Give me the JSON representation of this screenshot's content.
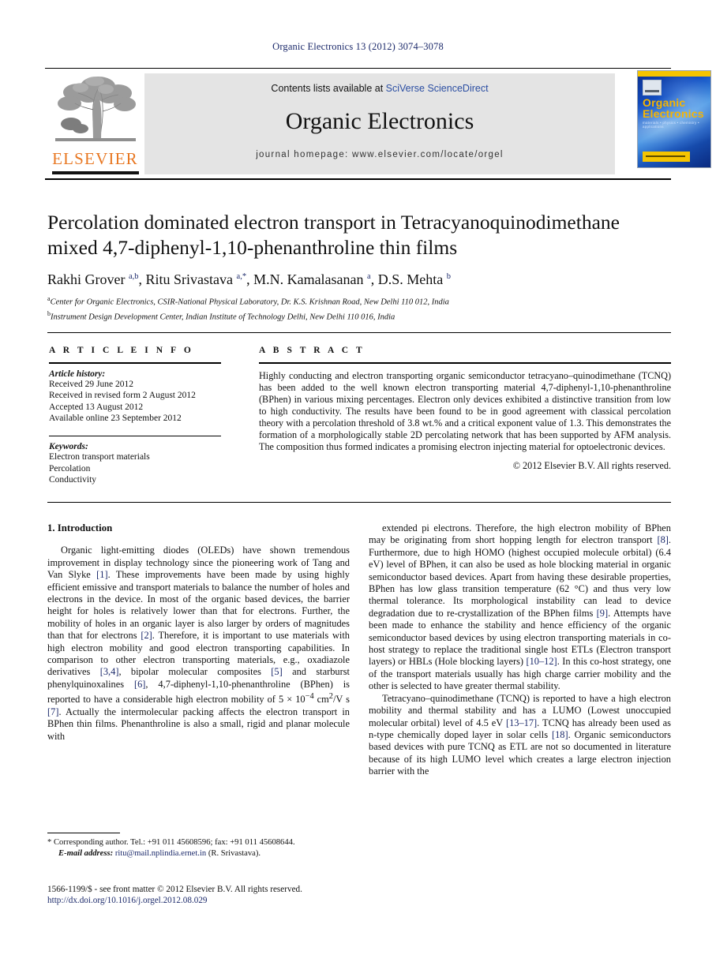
{
  "running_head": "Organic Electronics 13 (2012) 3074–3078",
  "masthead": {
    "contents_prefix": "Contents lists available at ",
    "contents_link": "SciVerse ScienceDirect",
    "journal_title": "Organic Electronics",
    "homepage": "journal homepage: www.elsevier.com/locate/orgel",
    "publisher_name": "ELSEVIER",
    "cover": {
      "title_line1": "Organic",
      "title_line2": "Electronics",
      "subtitle": "materials • physics • chemistry • applications"
    }
  },
  "article": {
    "title": "Percolation dominated electron transport in Tetracyanoquinodimethane mixed 4,7-diphenyl-1,10-phenanthroline thin films",
    "authors_html": "Rakhi Grover <sup>a,b</sup>, Ritu Srivastava <sup>a,*</sup>, M.N. Kamalasanan <sup>a</sup>, D.S. Mehta <sup>b</sup>",
    "affiliation_a": "Center for Organic Electronics, CSIR-National Physical Laboratory, Dr. K.S. Krishnan Road, New Delhi 110 012, India",
    "affiliation_b": "Instrument Design Development Center, Indian Institute of Technology Delhi, New Delhi 110 016, India"
  },
  "article_info": {
    "heading": "A R T I C L E   I N F O",
    "history_label": "Article history:",
    "history": [
      "Received 29 June 2012",
      "Received in revised form 2 August 2012",
      "Accepted 13 August 2012",
      "Available online 23 September 2012"
    ],
    "keywords_label": "Keywords:",
    "keywords": [
      "Electron transport materials",
      "Percolation",
      "Conductivity"
    ]
  },
  "abstract": {
    "heading": "A B S T R A C T",
    "text": "Highly conducting and electron transporting organic semiconductor tetracyano–quinodimethane (TCNQ) has been added to the well known electron transporting material 4,7-diphenyl-1,10-phenanthroline (BPhen) in various mixing percentages. Electron only devices exhibited a distinctive transition from low to high conductivity. The results have been found to be in good agreement with classical percolation theory with a percolation threshold of 3.8 wt.% and a critical exponent value of 1.3. This demonstrates the formation of a morphologically stable 2D percolating network that has been supported by AFM analysis. The composition thus formed indicates a promising electron injecting material for optoelectronic devices.",
    "copyright": "© 2012 Elsevier B.V. All rights reserved."
  },
  "body": {
    "section_heading": "1. Introduction",
    "left_paragraph_1_html": "Organic light-emitting diodes (OLEDs) have shown tremendous improvement in display technology since the pioneering work of Tang and Van Slyke <span class=\"ref\">[1]</span>. These improvements have been made by using highly efficient emissive and transport materials to balance the number of holes and electrons in the device. In most of the organic based devices, the barrier height for holes is relatively lower than that for electrons. Further, the mobility of holes in an organic layer is also larger by orders of magnitudes than that for electrons <span class=\"ref\">[2]</span>. Therefore, it is important to use materials with high electron mobility and good electron transporting capabilities. In comparison to other electron transporting materials, e.g., oxadiazole derivatives <span class=\"ref\">[3,4]</span>, bipolar molecular composites <span class=\"ref\">[5]</span> and starburst phenylquinoxalines <span class=\"ref\">[6]</span>, 4,7-diphenyl-1,10-phenanthroline (BPhen) is reported to have a considerable high electron mobility of 5 × 10<sup>−4</sup> cm<sup>2</sup>/V s <span class=\"ref\">[7]</span>. Actually the intermolecular packing affects the electron transport in BPhen thin films. Phenanthroline is also a small, rigid and planar molecule with",
    "right_paragraph_1_html": "extended pi electrons. Therefore, the high electron mobility of BPhen may be originating from short hopping length for electron transport <span class=\"ref\">[8]</span>. Furthermore, due to high HOMO (highest occupied molecule orbital) (6.4 eV) level of BPhen, it can also be used as hole blocking material in organic semiconductor based devices. Apart from having these desirable properties, BPhen has low glass transition temperature (62 °C) and thus very low thermal tolerance. Its morphological instability can lead to device degradation due to re-crystallization of the BPhen films <span class=\"ref\">[9]</span>. Attempts have been made to enhance the stability and hence efficiency of the organic semiconductor based devices by using electron transporting materials in co-host strategy to replace the traditional single host ETLs (Electron transport layers) or HBLs (Hole blocking layers) <span class=\"ref\">[10–12]</span>. In this co-host strategy, one of the transport materials usually has high charge carrier mobility and the other is selected to have greater thermal stability.",
    "right_paragraph_2_html": "Tetracyano–quinodimethane (TCNQ) is reported to have a high electron mobility and thermal stability and has a LUMO (Lowest unoccupied molecular orbital) level of 4.5 eV <span class=\"ref\">[13–17]</span>. TCNQ has already been used as n-type chemically doped layer in solar cells <span class=\"ref\">[18]</span>. Organic semiconductors based devices with pure TCNQ as ETL are not so documented in literature because of its high LUMO level which creates a large electron injection barrier with the"
  },
  "footnote": {
    "corresponding_html": "* Corresponding author. Tel.: +91 011 45608596; fax: +91 011 45608644.",
    "email_label": "E-mail address:",
    "email": "ritu@mail.nplindia.ernet.in",
    "email_owner": "(R. Srivastava)."
  },
  "bottom": {
    "issn_line": "1566-1199/$ - see front matter © 2012 Elsevier B.V. All rights reserved.",
    "doi": "http://dx.doi.org/10.1016/j.orgel.2012.08.029"
  },
  "colors": {
    "link_blue": "#1c2a6b",
    "sciencedirect_blue": "#2b4ea2",
    "elsevier_orange": "#E87722",
    "cover_yellow": "#f5c400"
  }
}
